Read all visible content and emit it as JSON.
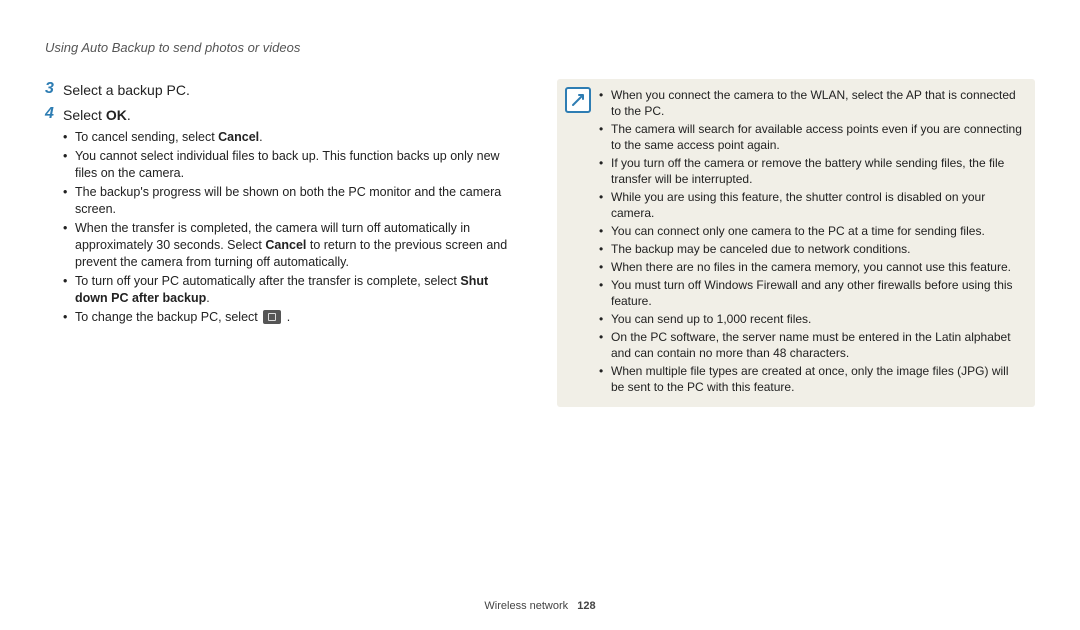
{
  "header": "Using Auto Backup to send photos or videos",
  "steps": [
    {
      "num": "3",
      "text": "Select a backup PC."
    },
    {
      "num": "4",
      "text_prefix": "Select ",
      "bold": "OK",
      "text_suffix": "."
    }
  ],
  "sub": [
    {
      "plain": "To cancel sending, select ",
      "bold": "Cancel",
      "tail": "."
    },
    {
      "plain": "You cannot select individual files to back up. This function backs up only new files on the camera."
    },
    {
      "plain": "The backup's progress will be shown on both the PC monitor and the camera screen."
    },
    {
      "plain": "When the transfer is completed, the camera will turn off automatically in approximately 30 seconds. Select ",
      "bold": "Cancel",
      "tail": " to return to the previous screen and prevent the camera from turning off automatically."
    },
    {
      "plain": "To turn off your PC automatically after the transfer is complete, select ",
      "bold2": "Shut down PC after backup",
      "tail": "."
    },
    {
      "plain": "To change the backup PC, select ",
      "icon": true,
      "tail": " ."
    }
  ],
  "notes": [
    "When you connect the camera to the WLAN, select the AP that is connected to the PC.",
    "The camera will search for available access points even if you are connecting to the same access point again.",
    "If you turn off the camera or remove the battery while sending files, the file transfer will be interrupted.",
    "While you are using this feature, the shutter control is disabled on your camera.",
    "You can connect only one camera to the PC at a time for sending files.",
    "The backup may be canceled due to network conditions.",
    "When there are no files in the camera memory, you cannot use this feature.",
    "You must turn off Windows Firewall and any other firewalls before using this feature.",
    "You can send up to 1,000 recent files.",
    "On the PC software, the server name must be entered in the Latin alphabet and can contain no more than 48 characters.",
    "When multiple file types are created at once, only the image files (JPG) will be sent to the PC with this feature."
  ],
  "footer_section": "Wireless network",
  "footer_page": "128"
}
